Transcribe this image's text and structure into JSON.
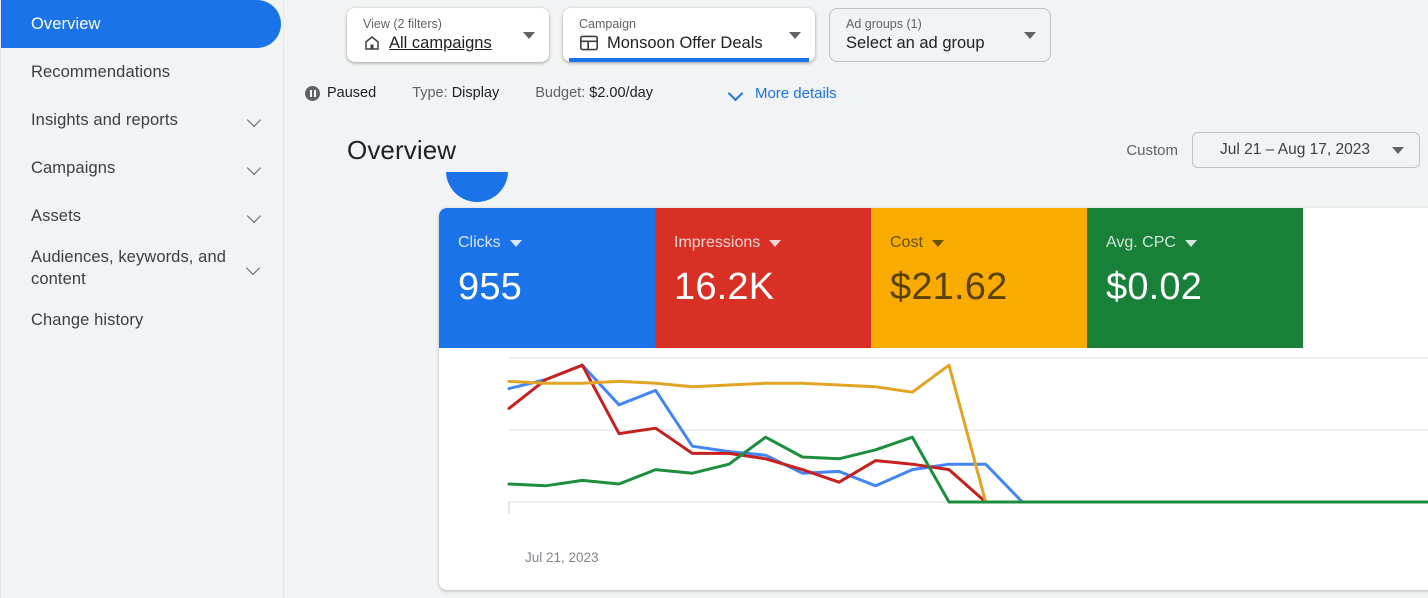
{
  "sidebar": {
    "items": [
      {
        "label": "Overview",
        "active": true,
        "expandable": false
      },
      {
        "label": "Recommendations",
        "active": false,
        "expandable": false
      },
      {
        "label": "Insights and reports",
        "active": false,
        "expandable": true
      },
      {
        "label": "Campaigns",
        "active": false,
        "expandable": true
      },
      {
        "label": "Assets",
        "active": false,
        "expandable": true
      },
      {
        "label": "Audiences, keywords, and content",
        "active": false,
        "expandable": true
      },
      {
        "label": "Change history",
        "active": false,
        "expandable": false
      }
    ]
  },
  "selectors": {
    "view": {
      "caption": "View (2 filters)",
      "value": "All campaigns",
      "icon": "home-icon"
    },
    "campaign": {
      "caption": "Campaign",
      "value": "Monsoon Offer Deals",
      "icon": "campaign-icon",
      "selected": true
    },
    "ad_groups": {
      "caption": "Ad groups (1)",
      "value": "Select an ad group"
    }
  },
  "status": {
    "state": "Paused",
    "type_label": "Type:",
    "type_value": "Display",
    "budget_label": "Budget:",
    "budget_value": "$2.00/day",
    "more_details": "More details"
  },
  "header": {
    "title": "Overview",
    "date_mode": "Custom",
    "date_range": "Jul 21 – Aug 17, 2023"
  },
  "metrics": [
    {
      "label": "Clicks",
      "value": "955",
      "bg": "#1a73e8",
      "fg": "#ffffff",
      "label_fg": "#d9e7fb"
    },
    {
      "label": "Impressions",
      "value": "16.2K",
      "bg": "#d93025",
      "fg": "#ffffff",
      "label_fg": "#f6d6d3"
    },
    {
      "label": "Cost",
      "value": "$21.62",
      "bg": "#f9ab00",
      "fg": "#594200",
      "label_fg": "#6b5000"
    },
    {
      "label": "Avg. CPC",
      "value": "$0.02",
      "bg": "#188038",
      "fg": "#ffffff",
      "label_fg": "#d2e7d8"
    }
  ],
  "chart_data": {
    "type": "line",
    "title": "",
    "xlabel": "",
    "ylabel": "",
    "grid": true,
    "legend": "none",
    "x_tick_labels": [
      "Jul 21, 2023"
    ],
    "x": [
      0,
      1,
      2,
      3,
      4,
      5,
      6,
      7,
      8,
      9,
      10,
      11,
      12,
      13,
      14,
      15,
      16,
      17,
      18,
      19,
      20,
      21,
      22,
      23,
      24,
      25,
      26,
      27
    ],
    "ylim": [
      0,
      100
    ],
    "series": [
      {
        "name": "Clicks",
        "color": "#4285f4",
        "values": [
          83,
          88,
          96,
          74,
          82,
          51,
          48,
          46,
          36,
          37,
          29,
          38,
          41,
          41,
          20,
          20,
          20,
          20,
          20,
          20,
          20,
          20,
          20,
          20,
          20,
          20,
          20,
          20
        ]
      },
      {
        "name": "Impressions",
        "color": "#c5221f",
        "values": [
          72,
          88,
          96,
          58,
          61,
          47,
          47,
          44,
          38,
          31,
          43,
          41,
          38,
          20,
          20,
          20,
          20,
          20,
          20,
          20,
          20,
          20,
          20,
          20,
          20,
          20,
          20,
          20
        ]
      },
      {
        "name": "Cost",
        "color": "#e0a526",
        "values": [
          87,
          86,
          86,
          87,
          86,
          84,
          85,
          86,
          86,
          85,
          84,
          81,
          96,
          20,
          20,
          20,
          20,
          20,
          20,
          20,
          20,
          20,
          20,
          20,
          20,
          20,
          20,
          20
        ]
      },
      {
        "name": "Avg. CPC",
        "color": "#1e8e3e",
        "values": [
          30,
          29,
          32,
          30,
          38,
          36,
          41,
          56,
          45,
          44,
          49,
          56,
          20,
          20,
          20,
          20,
          20,
          20,
          20,
          20,
          20,
          20,
          20,
          20,
          20,
          20,
          20,
          20
        ]
      }
    ]
  }
}
